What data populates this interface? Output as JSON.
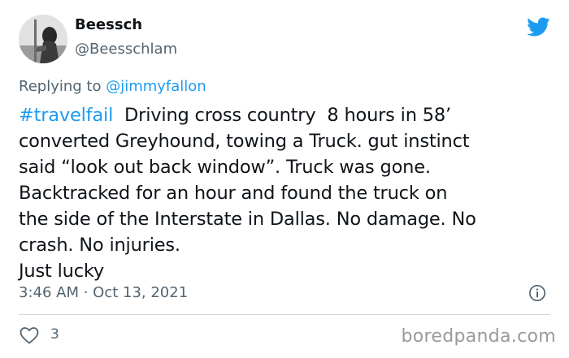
{
  "user": {
    "display_name": "Beessch",
    "handle": "@Beesschlam"
  },
  "reply": {
    "prefix": "Replying to ",
    "mention": "@jimmyfallon"
  },
  "tweet": {
    "hashtag": "#travelfail",
    "line1_rest": "  Driving cross country  8 hours in 58’",
    "line2": "converted Greyhound, towing a Truck. gut instinct",
    "line3": "said “look out back window”. Truck was gone.",
    "line4": "Backtracked for an hour and found the truck on",
    "line5": "the side of the Interstate in Dallas. No damage. No",
    "line6": "crash. No injuries.",
    "line7": "Just lucky"
  },
  "meta": {
    "timestamp": "3:46 AM · Oct 13, 2021"
  },
  "actions": {
    "like_count": "3"
  },
  "watermark": "boredpanda.com",
  "colors": {
    "link_blue": "#1d9bf0",
    "twitter_blue": "#1d9bf0",
    "secondary_text": "#536471",
    "watermark_gray": "#9a9a9a"
  },
  "icons": {
    "brand": "twitter-bird-icon",
    "info": "info-icon",
    "like": "heart-icon"
  }
}
